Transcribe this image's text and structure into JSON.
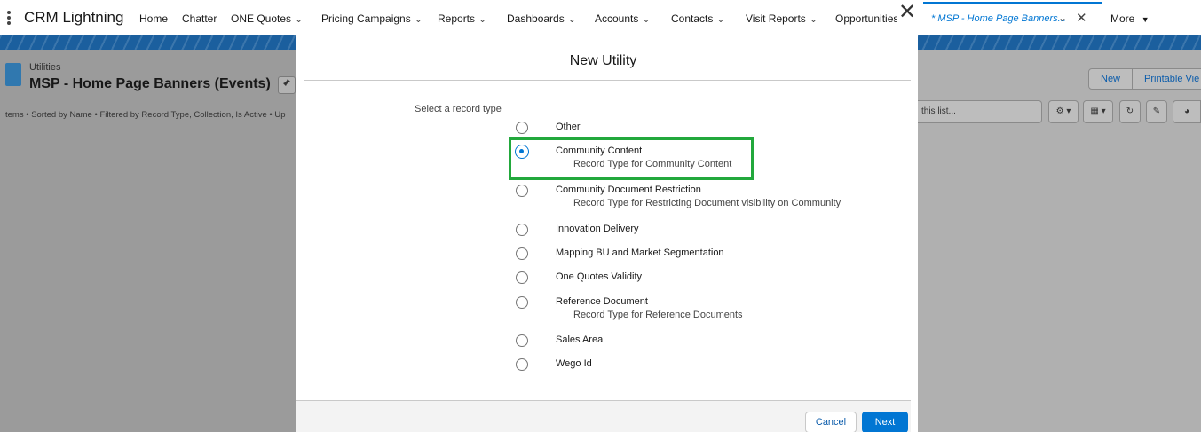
{
  "topnav": {
    "app_name": "CRM Lightning",
    "items": [
      {
        "label": "Home",
        "chevron": false
      },
      {
        "label": "Chatter",
        "chevron": false
      },
      {
        "label": "ONE Quotes",
        "chevron": true
      },
      {
        "label": "Pricing Campaigns",
        "chevron": true
      },
      {
        "label": "Reports",
        "chevron": true
      },
      {
        "label": "Dashboards",
        "chevron": true
      },
      {
        "label": "Accounts",
        "chevron": true
      },
      {
        "label": "Contacts",
        "chevron": true
      },
      {
        "label": "Visit Reports",
        "chevron": true
      },
      {
        "label": "Opportunities",
        "chevron": true
      }
    ],
    "active_tab": "* MSP - Home Page Banners...",
    "more_label": "More",
    "chevron_glyph": "⌄",
    "close_glyph": "✕",
    "more_glyph": "▼"
  },
  "list_view": {
    "object_label": "Utilities",
    "title": "MSP - Home Page Banners (Events)",
    "title_caret": "▼",
    "info": "tems • Sorted by Name • Filtered by Record Type, Collection, Is Active • Up",
    "buttons": [
      "New",
      "Printable Vie"
    ],
    "search_placeholder": "this list...",
    "tool_icons": [
      "gear-icon",
      "table-icon",
      "refresh-icon",
      "edit-icon",
      "chart-icon"
    ]
  },
  "modal": {
    "title": "New Utility",
    "close_glyph": "✕",
    "record_type_label": "Select a record type",
    "selected_option": "Community Content",
    "options": [
      {
        "name": "Other",
        "desc": "",
        "checked": false
      },
      {
        "name": "Community Content",
        "desc": "Record Type for Community Content",
        "checked": true
      },
      {
        "name": "Community Document Restriction",
        "desc": "Record Type for Restricting Document visibility on Community",
        "checked": false
      },
      {
        "name": "Innovation Delivery",
        "desc": "",
        "checked": false
      },
      {
        "name": "Mapping BU and Market Segmentation",
        "desc": "",
        "checked": false
      },
      {
        "name": "One Quotes Validity",
        "desc": "",
        "checked": false
      },
      {
        "name": "Reference Document",
        "desc": "Record Type for Reference Documents",
        "checked": false
      },
      {
        "name": "Sales Area",
        "desc": "",
        "checked": false
      },
      {
        "name": "Wego Id",
        "desc": "",
        "checked": false
      }
    ],
    "cancel_label": "Cancel",
    "next_label": "Next"
  },
  "colors": {
    "brand": "#0176d3",
    "highlight": "#22a83c"
  }
}
